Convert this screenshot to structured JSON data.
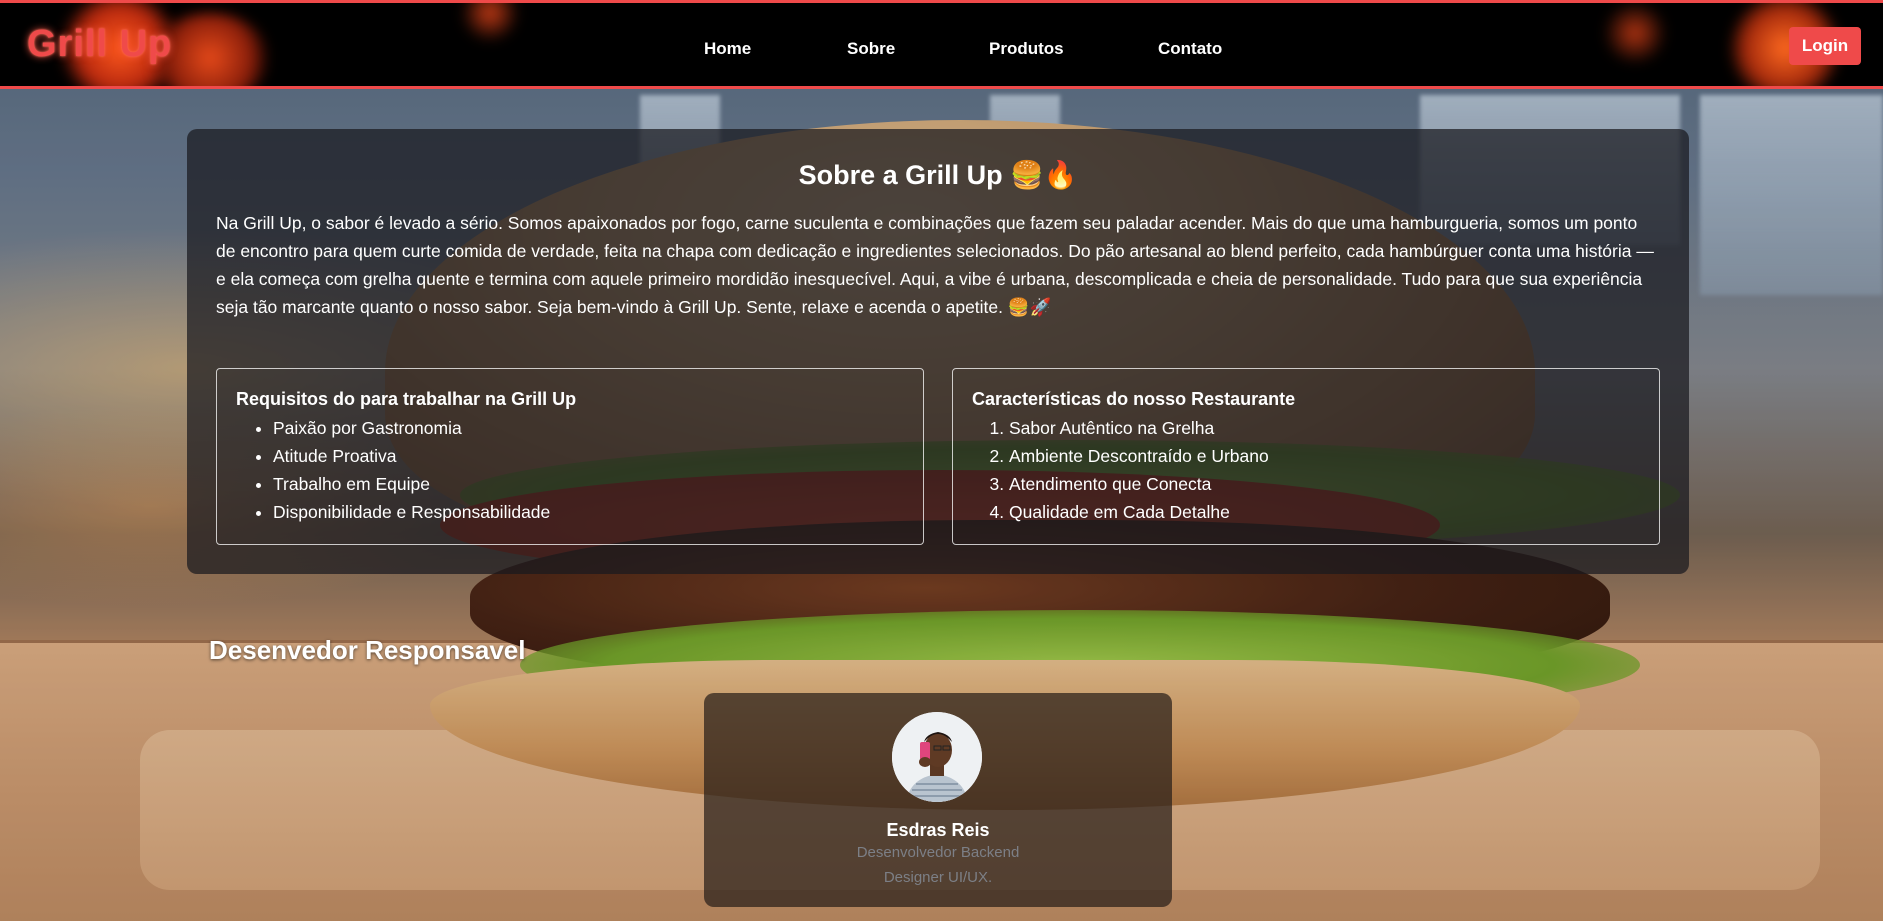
{
  "header": {
    "logo": "Grill Up",
    "nav": [
      {
        "label": "Home"
      },
      {
        "label": "Sobre"
      },
      {
        "label": "Produtos"
      },
      {
        "label": "Contato"
      }
    ],
    "login_label": "Login"
  },
  "about": {
    "title": "Sobre a Grill Up 🍔🔥",
    "text": "Na Grill Up, o sabor é levado a sério. Somos apaixonados por fogo, carne suculenta e combinações que fazem seu paladar acender. Mais do que uma hamburgueria, somos um ponto de encontro para quem curte comida de verdade, feita na chapa com dedicação e ingredientes selecionados. Do pão artesanal ao blend perfeito, cada hambúrguer conta uma história — e ela começa com grelha quente e termina com aquele primeiro mordidão inesquecível. Aqui, a vibe é urbana, descomplicada e cheia de personalidade. Tudo para que sua experiência seja tão marcante quanto o nosso sabor. Seja bem-vindo à Grill Up. Sente, relaxe e acenda o apetite. 🍔🚀",
    "requirements": {
      "title": "Requisitos do para trabalhar na Grill Up",
      "items": [
        "Paixão por Gastronomia",
        "Atitude Proativa",
        "Trabalho em Equipe",
        "Disponibilidade e Responsabilidade"
      ]
    },
    "features": {
      "title": "Características do nosso Restaurante",
      "items": [
        "Sabor Autêntico na Grelha",
        "Ambiente Descontraído e Urbano",
        "Atendimento que Conecta",
        "Qualidade em Cada Detalhe"
      ]
    }
  },
  "developer": {
    "heading": "Desenvedor Responsavel",
    "name": "Esdras Reis",
    "roles": [
      "Desenvolvedor Backend",
      "Designer UI/UX."
    ]
  },
  "colors": {
    "accent": "#ef4a4a",
    "header_bg": "#000000",
    "panel_bg": "rgba(25,25,30,0.72)"
  }
}
